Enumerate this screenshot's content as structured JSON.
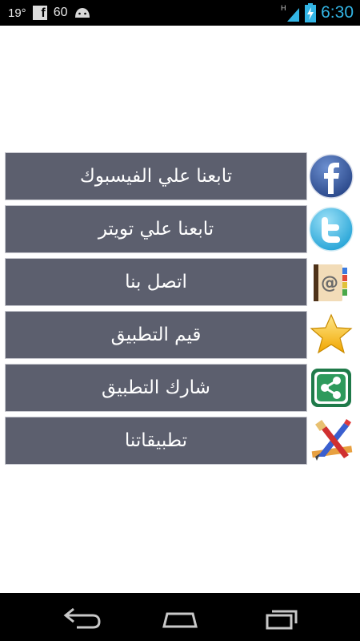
{
  "status_bar": {
    "temperature": "19°",
    "facebook_glyph": "f",
    "notification_count": "60",
    "network_type": "H",
    "time": "6:30",
    "time_color": "#33b5e5",
    "icons": [
      "facebook-notification-icon",
      "android-icon",
      "signal-icon",
      "battery-charging-icon"
    ]
  },
  "menu": {
    "button_color": "#5c5f6e",
    "items": [
      {
        "label": "تابعنا علي الفيسبوك",
        "icon": "facebook-icon"
      },
      {
        "label": "تابعنا علي تويتر",
        "icon": "twitter-icon"
      },
      {
        "label": "اتصل بنا",
        "icon": "address-book-icon"
      },
      {
        "label": "قيم التطبيق",
        "icon": "star-icon"
      },
      {
        "label": "شارك التطبيق",
        "icon": "share-icon"
      },
      {
        "label": "تطبيقاتنا",
        "icon": "apps-tools-icon"
      }
    ]
  },
  "nav_bar": {
    "buttons": [
      "back-icon",
      "home-icon",
      "recent-apps-icon"
    ]
  }
}
